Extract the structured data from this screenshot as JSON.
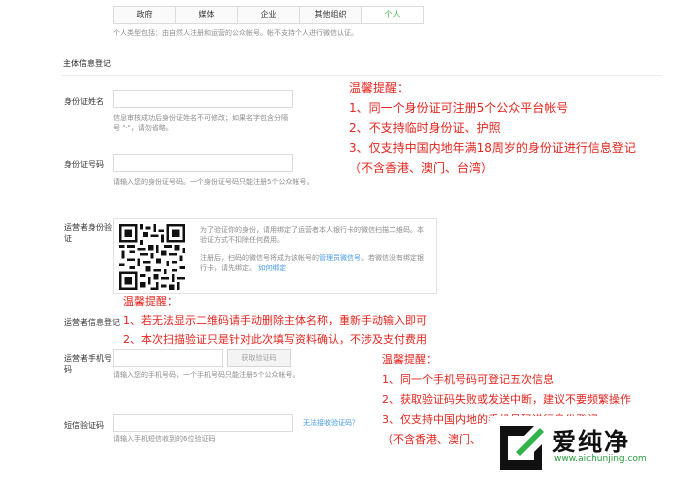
{
  "tabs": [
    "政府",
    "媒体",
    "企业",
    "其他组织",
    "个人"
  ],
  "type_desc": "个人类型包括：由自然人注册和运营的公众帐号。帐不支持个人进行微信认证。",
  "section_title": "主体信息登记",
  "name": {
    "label": "身份证姓名",
    "hint": "信息审核成功后身份证姓名不可修改；如果名字包含分隔号 \"·\"，请勿省略。"
  },
  "idnum": {
    "label": "身份证号码",
    "hint": "请输入您的身份证号码。一个身份证号码只能注册5个公众帐号。"
  },
  "operator_verify": {
    "label": "运营者身份验证",
    "text1": "为了验证你的身份，请用绑定了运营者本人银行卡的微信扫描二维码。本验证方式不扣除任何费用。",
    "text2a": "注册后，扫码的微信号将成为该帐号的",
    "text2_link": "管理员微信号",
    "text2b": "。若微信没有绑定银行卡，请先绑定。",
    "link": "如何绑定"
  },
  "operator_info_label": "运营者信息登记",
  "phone": {
    "label": "运营者手机号码",
    "button": "获取验证码",
    "hint": "请输入您的手机号码，一个手机号码只能注册5个公众帐号。"
  },
  "sms": {
    "label": "短信验证码",
    "link": "无法接收验证码？",
    "hint": "请输入手机短信收到的6位验证码"
  },
  "warnings": {
    "w1": [
      "温馨提醒：",
      "1、同一个身份证可注册5个公众平台帐号",
      "2、不支持临时身份证、护照",
      "3、仅支持中国内地年满18周岁的身份证进行信息登记",
      "（不含香港、澳门、台湾）"
    ],
    "w2": [
      "温馨提醒：",
      "1、若无法显示二维码请手动删除主体名称，重新手动输入即可",
      "2、本次扫描验证只是针对此次填写资料确认，不涉及支付费用"
    ],
    "w3": [
      "温馨提醒：",
      "1、同一个手机号码可登记五次信息",
      "2、获取验证码失败或发送中断，建议不要频繁操作",
      "3、仅支持中国内地的手机号码进行身份登记",
      "（不含香港、澳门、"
    ]
  },
  "logo": {
    "text": "爱纯净",
    "url": "www.aichunjing.com"
  },
  "colors": {
    "warning": "#e5251e",
    "active_tab": "#44b549",
    "link": "#459ae9"
  }
}
